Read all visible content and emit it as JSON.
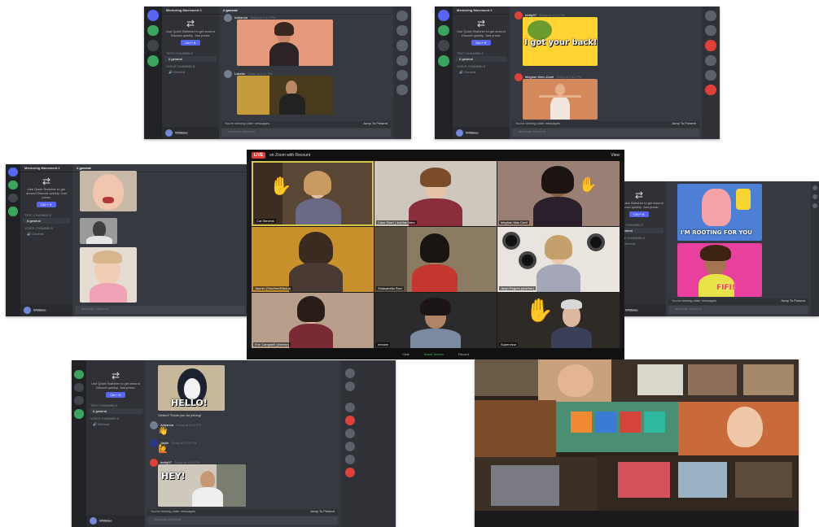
{
  "panels": {
    "d1": {
      "server": "Mentoring Movement 2",
      "channel": "general",
      "promo": "Use Quick Switcher to get around Discord quickly. Just press:",
      "promo_btn": "Ctrl + K",
      "cat_text": "Text Channels",
      "chan_text": "general",
      "cat_voice": "Voice Channels",
      "chan_voice": "General",
      "msgs": [
        {
          "user": "Adrianna",
          "ts": "Today at 5:10 PM"
        },
        {
          "user": "Lakelia",
          "ts": "Today at 5:11 PM"
        }
      ],
      "banner": "You're viewing older messages",
      "jump": "Jump To Present",
      "input": "Message #general",
      "me": "Whitelee"
    },
    "d2": {
      "server": "Mentoring Movement 2",
      "promo": "Use Quick Switcher to get around Discord quickly. Just press:",
      "promo_btn": "Ctrl + K",
      "cat_text": "Text Channels",
      "chan_text": "general",
      "cat_voice": "Voice Channels",
      "chan_voice": "General",
      "msgs": [
        {
          "user": "trinity97",
          "ts": "Today at 5:12 PM"
        },
        {
          "user": "Meghan Klein-Donti",
          "ts": "Today at 5:12 PM"
        }
      ],
      "gif1_text": "I got your back!",
      "banner": "You're viewing older messages",
      "jump": "Jump To Present",
      "input": "Message #general",
      "me": "Whitelee"
    },
    "d3": {
      "server": "Mentoring Movement 2",
      "channel": "general",
      "promo": "Use Quick Switcher to get around Discord quickly. Just press:",
      "promo_btn": "Ctrl + K",
      "cat_text": "Text Channels",
      "chan_text": "general",
      "cat_voice": "Voice Channels",
      "chan_voice": "General",
      "input": "Message #general",
      "me": "Whitelee"
    },
    "d4": {
      "promo": "Use Quick Switcher to get around Discord quickly. Just press:",
      "promo_btn": "Ctrl + K",
      "cat_text": "Text Channels",
      "chan_text": "general",
      "cat_voice": "Voice Channels",
      "chan_voice": "General",
      "gif1_text": "I'M ROOTING FOR YOU",
      "gif2_text": "FIFI!",
      "banner": "You're viewing older messages",
      "jump": "Jump To Present",
      "input": "Message #general",
      "me": "Whitelee"
    },
    "d5": {
      "promo": "Use Quick Switcher to get around Discord quickly. Just press:",
      "promo_btn": "Ctrl + K",
      "cat_text": "Text Channels",
      "chan_text": "general",
      "cat_voice": "Voice Channels",
      "chan_voice": "General",
      "gif1_text": "HELLO!",
      "gif2_text": "HEY!",
      "reply": "Omiko!! Thank you for joining!",
      "msgs": [
        {
          "user": "Adrianna",
          "ts": "Today at 5:03 PM"
        },
        {
          "user": "Jaylin",
          "ts": "Today at 5:03 PM"
        },
        {
          "user": "trinity97",
          "ts": "Today at 5:04 PM"
        }
      ],
      "banner": "You're viewing older messages",
      "jump": "Jump To Present",
      "input": "Message #general",
      "me": "Whitelee"
    }
  },
  "zoom": {
    "live": "LIVE",
    "title": "on Zoom with Recount",
    "view": "View",
    "participants": [
      "Cat Stevens",
      "Cass Shorr | she/her/hers",
      "Meghan Mac Dorit",
      "Jasmin (She/Her/Ella/La)",
      "Shalsabella Ravi",
      "Jaryn Rogers (she/her)",
      "Erin Campbell (she/her)",
      "nbrown",
      "Supervisor"
    ],
    "controls": [
      "Chat",
      "Share Screen",
      "Record"
    ]
  }
}
